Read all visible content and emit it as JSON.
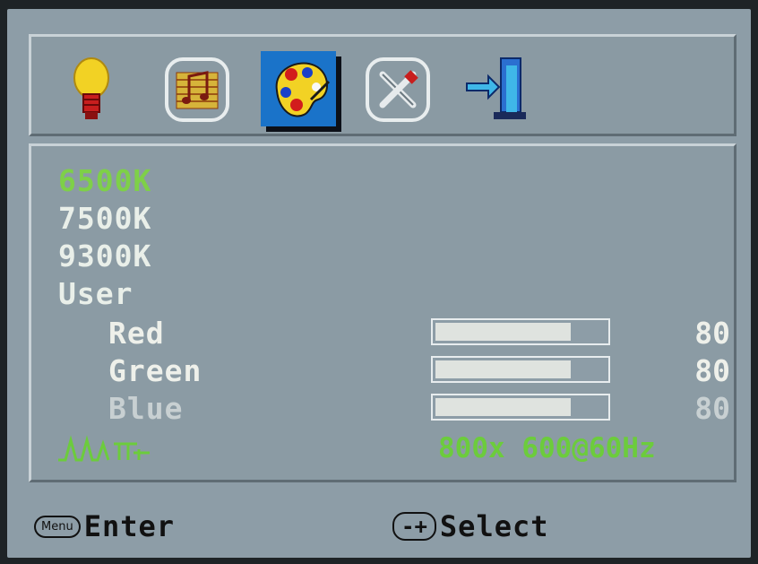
{
  "icon_bar": {
    "icons": [
      "lightbulb-icon",
      "music-notes-icon",
      "palette-icon",
      "tools-icon",
      "exit-door-icon"
    ],
    "selected": "palette-icon"
  },
  "color_menu": {
    "items": [
      {
        "label": "6500K",
        "selected": true
      },
      {
        "label": "7500K",
        "selected": false
      },
      {
        "label": "9300K",
        "selected": false
      },
      {
        "label": "User",
        "selected": false
      }
    ],
    "user_channels": [
      {
        "label": "Red",
        "value": "80",
        "level_percent": 80
      },
      {
        "label": "Green",
        "value": "80",
        "level_percent": 80
      },
      {
        "label": "Blue",
        "value": "80",
        "level_percent": 80
      }
    ]
  },
  "status": {
    "signal_icon": "signal-waveform-icon",
    "resolution": "800x 600@60Hz"
  },
  "footer": {
    "enter_button": "Menu",
    "enter_label": "Enter",
    "select_button": "-+",
    "select_label": "Select"
  },
  "colors": {
    "selected_text": "#7ed048",
    "text": "#e9efe9",
    "panel": "#8b9ba4",
    "highlight_bg": "#1a73c9"
  }
}
